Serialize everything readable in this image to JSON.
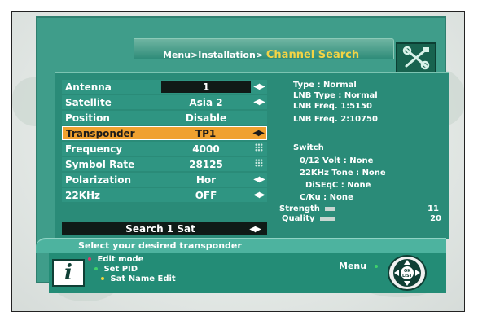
{
  "breadcrumb": {
    "path": "Menu>Installation>",
    "current": "Channel Search"
  },
  "settings": [
    {
      "label": "Antenna",
      "value": "1",
      "control": "arrows"
    },
    {
      "label": "Satellite",
      "value": "Asia 2",
      "control": "arrows"
    },
    {
      "label": "Position",
      "value": "Disable",
      "control": "none"
    },
    {
      "label": "Transponder",
      "value": "TP1",
      "control": "arrows",
      "selected": true
    },
    {
      "label": "Frequency",
      "value": "4000",
      "control": "keypad"
    },
    {
      "label": "Symbol Rate",
      "value": "28125",
      "control": "keypad"
    },
    {
      "label": "Polarization",
      "value": "Hor",
      "control": "arrows"
    },
    {
      "label": "22KHz",
      "value": "OFF",
      "control": "arrows"
    }
  ],
  "search_button": {
    "label": "Search 1 Sat"
  },
  "info": {
    "type": "Type : Normal",
    "lnb_type": "LNB Type : Normal",
    "lnb_freq1": "LNB Freq. 1:5150",
    "lnb_freq2": "LNB Freq. 2:10750",
    "switch_title": "Switch",
    "volt": "0/12 Volt : None",
    "tone": "22KHz Tone : None",
    "diseqc": "DiSEqC : None",
    "cku": "C/Ku : None"
  },
  "signal": {
    "strength_label": "Strength",
    "strength_value": "11",
    "quality_label": "Quality",
    "quality_value": "20"
  },
  "help": {
    "text": "Select your desired transponder"
  },
  "legend": {
    "edit_mode": "Edit mode",
    "set_pid": "Set PID",
    "sat_name_edit": "Sat Name Edit",
    "menu": "Menu",
    "ok_list": "OK LIST"
  },
  "colors": {
    "panel": "#3f9d8a",
    "highlight": "#f0a12f",
    "title_accent": "#f4d445",
    "edit_mode_dot": "#d63a6a",
    "set_pid_dot": "#3fd16b",
    "sat_name_dot": "#f2d53a",
    "menu_dot": "#3fd16b"
  },
  "icons": [
    "tools-icon",
    "info-icon",
    "left-right-arrows-icon",
    "keypad-icon",
    "nav-pad-icon"
  ]
}
